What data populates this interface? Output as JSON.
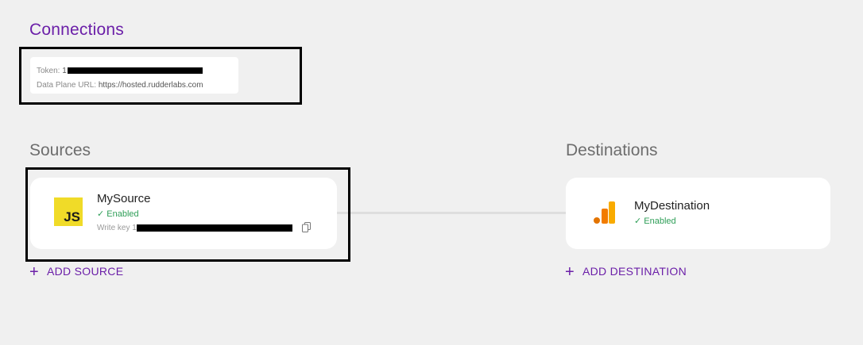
{
  "page": {
    "title": "Connections"
  },
  "token_card": {
    "token_label": "Token:",
    "token_prefix": "1",
    "data_plane_label": "Data Plane URL:",
    "data_plane_value": "https://hosted.rudderlabs.com"
  },
  "sources": {
    "title": "Sources",
    "card": {
      "icon": "js-icon",
      "icon_text": "JS",
      "name": "MySource",
      "status": "Enabled",
      "write_key_label": "Write key",
      "write_key_prefix": "1"
    },
    "add_label": "ADD SOURCE"
  },
  "destinations": {
    "title": "Destinations",
    "card": {
      "icon": "google-analytics-icon",
      "name": "MyDestination",
      "status": "Enabled"
    },
    "add_label": "ADD DESTINATION"
  },
  "colors": {
    "brand_purple": "#6b1fa8",
    "status_green": "#2e9e57",
    "background": "#f0f0f0",
    "js_yellow": "#f0db28",
    "ga_orange": "#f9ab00",
    "ga_dark_orange": "#e37400"
  }
}
